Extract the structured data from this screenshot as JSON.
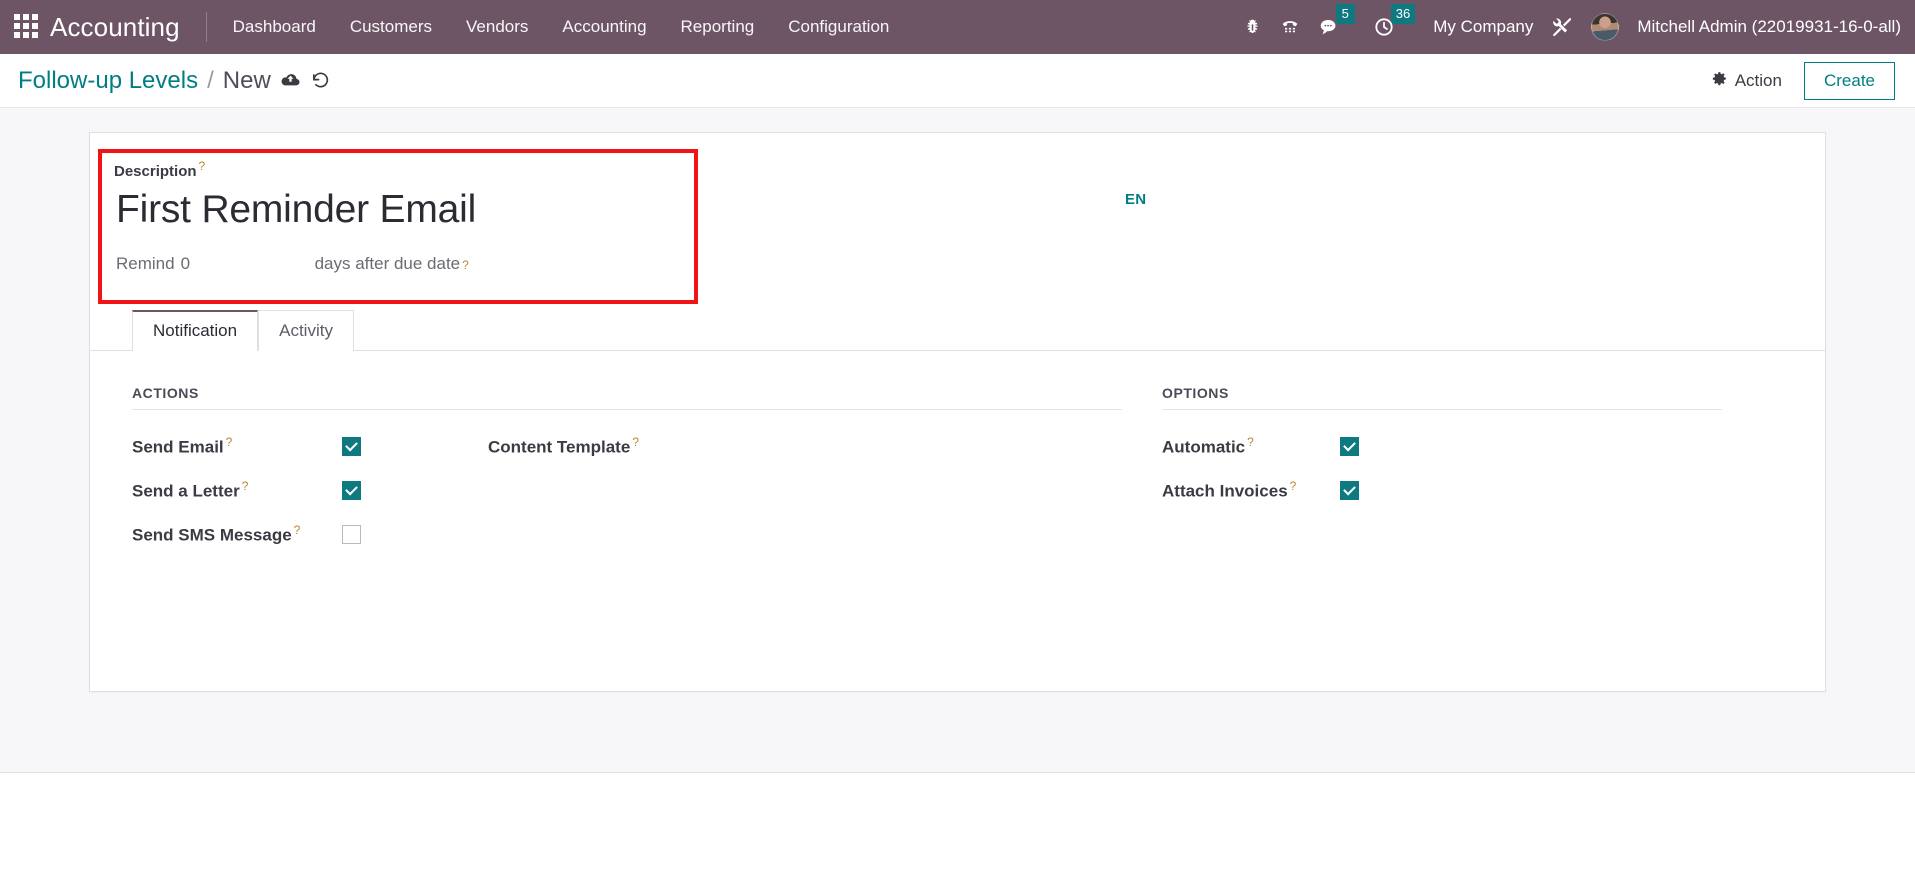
{
  "navbar": {
    "apps_icon": "apps-grid-icon",
    "brand": "Accounting",
    "menu": [
      {
        "label": "Dashboard"
      },
      {
        "label": "Customers"
      },
      {
        "label": "Vendors"
      },
      {
        "label": "Accounting"
      },
      {
        "label": "Reporting"
      },
      {
        "label": "Configuration"
      }
    ],
    "systray": {
      "bug_icon": "bug-icon",
      "dialpad_icon": "telephone-dialpad-icon",
      "messages_icon": "chat-bubble-icon",
      "messages_count": "5",
      "activities_icon": "clock-icon",
      "activities_count": "36",
      "company": "My Company",
      "tools_icon": "wrench-screwdriver-icon",
      "avatar": "user-avatar",
      "user": "Mitchell Admin (22019931-16-0-all)"
    }
  },
  "control_panel": {
    "breadcrumb_parent": "Follow-up Levels",
    "breadcrumb_separator": "/",
    "breadcrumb_current": "New",
    "save_icon": "cloud-upload-icon",
    "discard_icon": "undo-discard-icon",
    "action_label": "Action",
    "action_icon": "gear-icon",
    "create_label": "Create"
  },
  "form": {
    "description_label": "Description",
    "description_tip": "?",
    "description_value": "First Reminder Email",
    "remind_prefix": "Remind",
    "delay_value": "0",
    "remind_suffix": "days after due date",
    "remind_tip": "?",
    "language_badge": "EN"
  },
  "notebook": {
    "tabs": [
      {
        "label": "Notification",
        "active": true
      },
      {
        "label": "Activity",
        "active": false
      }
    ]
  },
  "actions_section": {
    "title": "ACTIONS",
    "fields": [
      {
        "label": "Send Email",
        "tip": "?",
        "checked": true
      },
      {
        "label": "Send a Letter",
        "tip": "?",
        "checked": true
      },
      {
        "label": "Send SMS Message",
        "tip": "?",
        "checked": false
      }
    ],
    "content_template_label": "Content Template",
    "content_template_tip": "?"
  },
  "options_section": {
    "title": "OPTIONS",
    "fields": [
      {
        "label": "Automatic",
        "tip": "?",
        "checked": true
      },
      {
        "label": "Attach Invoices",
        "tip": "?",
        "checked": true
      }
    ]
  },
  "colors": {
    "navbar_bg": "#6d5566",
    "accent_teal": "#017e84",
    "checkbox_teal": "#0e7a80",
    "annotation_red": "#f01414",
    "sheet_bg": "#f7f7f9"
  }
}
